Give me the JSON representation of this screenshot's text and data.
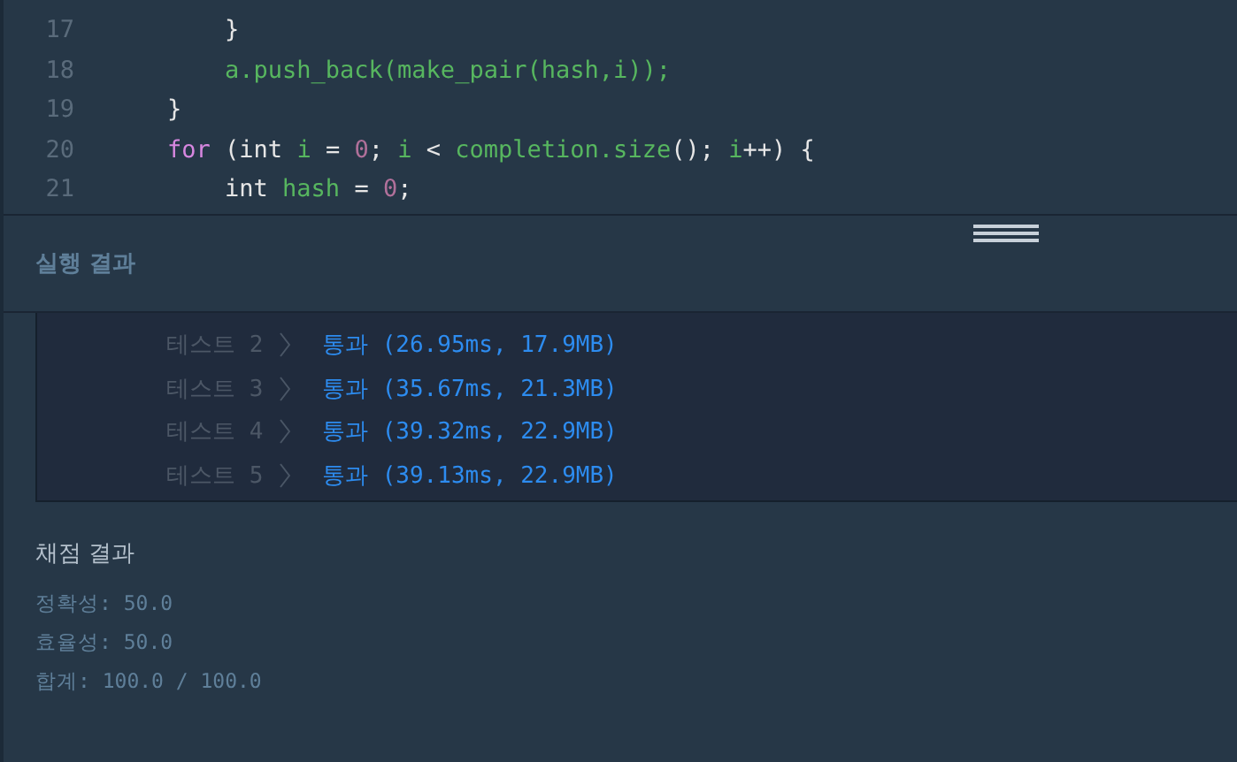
{
  "editor": {
    "lines": [
      {
        "number": "17",
        "tokens": [
          {
            "text": "        }",
            "kind": "plain"
          }
        ]
      },
      {
        "number": "18",
        "tokens": [
          {
            "text": "        a.push_back(make_pair(hash,i));",
            "kind": "ident"
          }
        ]
      },
      {
        "number": "19",
        "tokens": [
          {
            "text": "    }",
            "kind": "plain"
          }
        ]
      },
      {
        "number": "20",
        "tokens": [
          {
            "text": "    for",
            "kind": "keyword"
          },
          {
            "text": " (int ",
            "kind": "plain"
          },
          {
            "text": "i",
            "kind": "ident"
          },
          {
            "text": " = ",
            "kind": "plain"
          },
          {
            "text": "0",
            "kind": "number"
          },
          {
            "text": "; ",
            "kind": "plain"
          },
          {
            "text": "i",
            "kind": "ident"
          },
          {
            "text": " < ",
            "kind": "plain"
          },
          {
            "text": "completion.size",
            "kind": "ident"
          },
          {
            "text": "(); ",
            "kind": "plain"
          },
          {
            "text": "i",
            "kind": "ident"
          },
          {
            "text": "++) {",
            "kind": "plain"
          }
        ]
      },
      {
        "number": "21",
        "tokens": [
          {
            "text": "        int ",
            "kind": "plain"
          },
          {
            "text": "hash",
            "kind": "ident"
          },
          {
            "text": " = ",
            "kind": "plain"
          },
          {
            "text": "0",
            "kind": "number"
          },
          {
            "text": ";",
            "kind": "plain"
          }
        ]
      }
    ]
  },
  "run_result": {
    "title": "실행 결과",
    "tests": [
      {
        "label": "테스트 2",
        "result": "통과 (26.95ms, 17.9MB)"
      },
      {
        "label": "테스트 3",
        "result": "통과 (35.67ms, 21.3MB)"
      },
      {
        "label": "테스트 4",
        "result": "통과 (39.32ms, 22.9MB)"
      },
      {
        "label": "테스트 5",
        "result": "통과 (39.13ms, 22.9MB)"
      }
    ]
  },
  "grading": {
    "title": "채점 결과",
    "lines": [
      "정확성: 50.0",
      "효율성: 50.0",
      "합계: 100.0 / 100.0"
    ]
  }
}
